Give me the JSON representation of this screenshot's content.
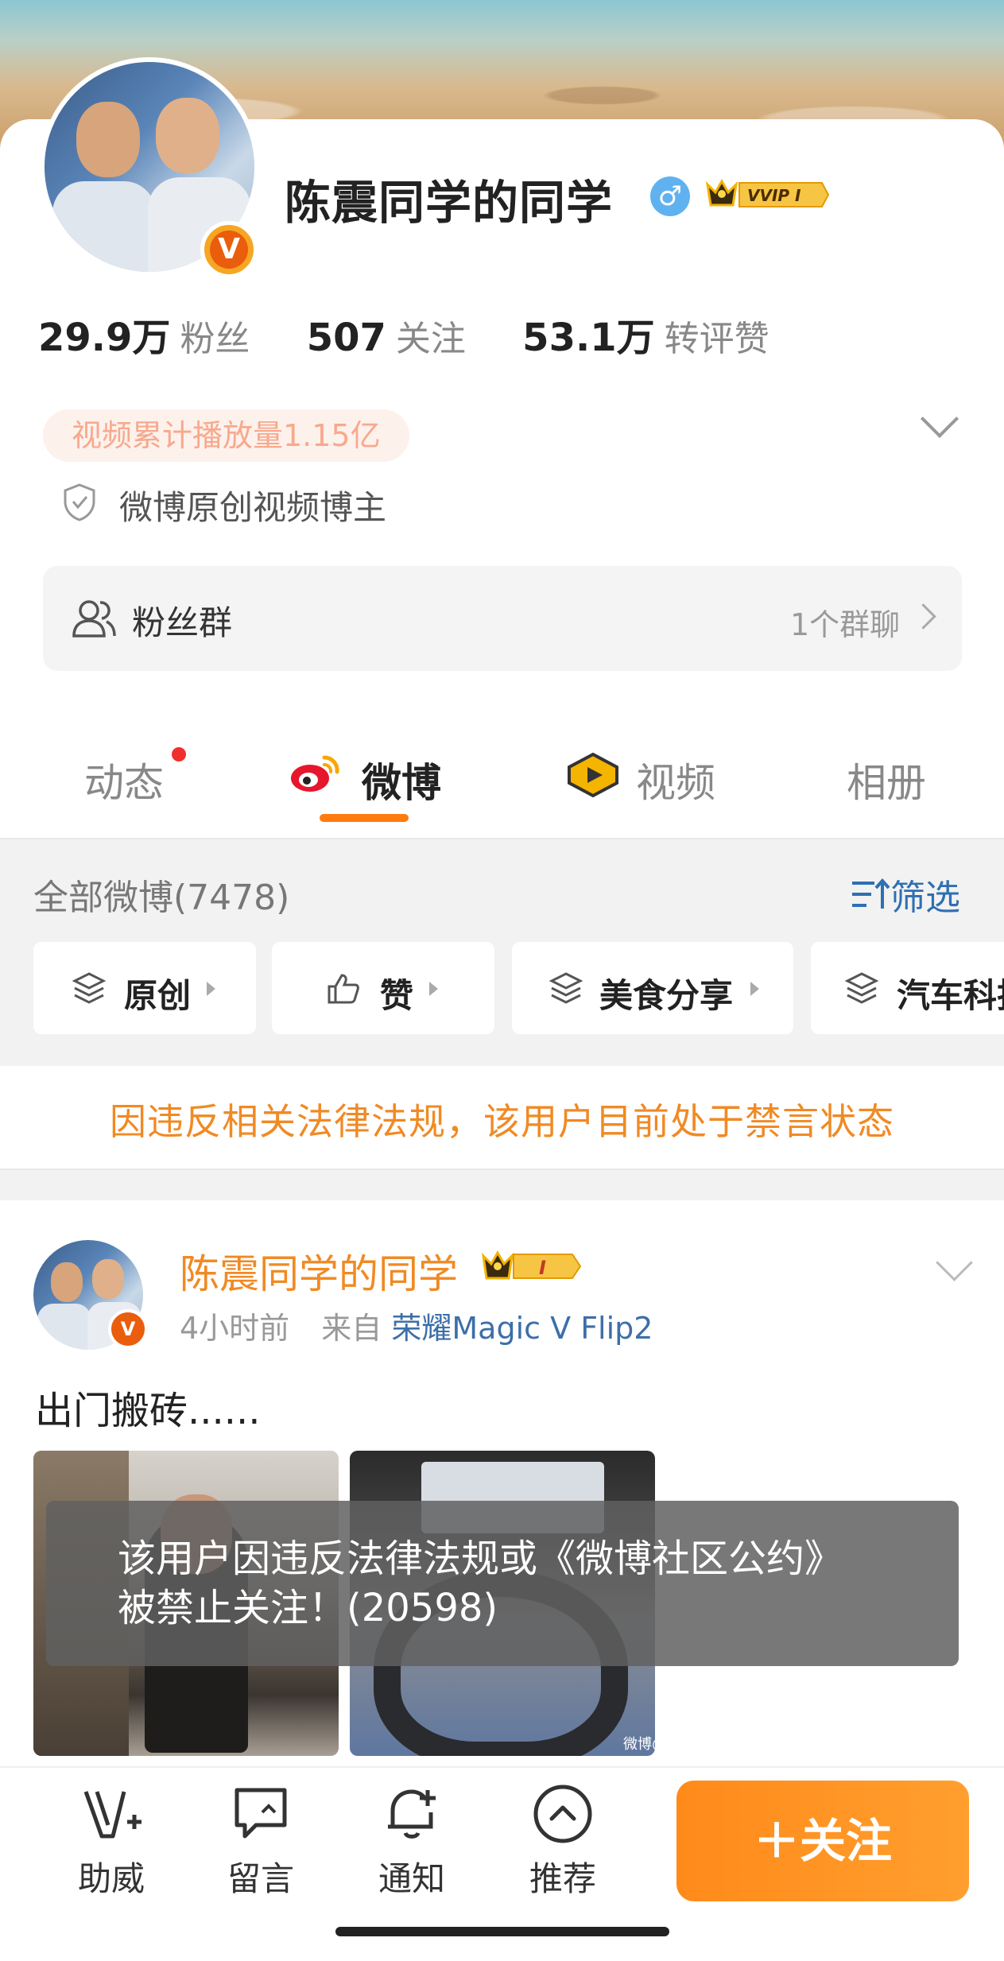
{
  "profile": {
    "name": "陈震同学的同学",
    "gender_symbol": "♂",
    "vip_badge": "VVIP Ⅰ",
    "verified_mark": "V",
    "stats": [
      {
        "value": "29.9万",
        "label": "粉丝"
      },
      {
        "value": "507",
        "label": "关注"
      },
      {
        "value": "53.1万",
        "label": "转评赞"
      }
    ],
    "highlight_pill": "视频累计播放量1.15亿",
    "certification": "微博原创视频博主",
    "fan_group": {
      "label": "粉丝群",
      "count_text": "1个群聊"
    }
  },
  "tabs": [
    {
      "label": "动态"
    },
    {
      "label": "微博"
    },
    {
      "label": "视频"
    },
    {
      "label": "相册"
    }
  ],
  "feed_header": {
    "all_label": "全部微博(7478)",
    "filter_label": "筛选"
  },
  "chips": [
    {
      "label": "原创",
      "icon": "layers-icon"
    },
    {
      "label": "赞",
      "icon": "thumb-up-icon"
    },
    {
      "label": "美食分享",
      "icon": "layers-icon"
    },
    {
      "label": "汽车科技",
      "icon": "layers-icon"
    }
  ],
  "ban_notice": "因违反相关法律法规，该用户目前处于禁言状态",
  "post": {
    "author": "陈震同学的同学",
    "badge": "Ⅰ",
    "time": "4小时前",
    "source_prefix": "来自",
    "device": "荣耀Magic V Flip2",
    "text": "出门搬砖......",
    "watermark": "微博@"
  },
  "overlay_message": "该用户因违反法律法规或《微博社区公约》被禁止关注！(20598)",
  "bottom_nav": [
    {
      "label": "助威",
      "icon": "cheer-icon"
    },
    {
      "label": "留言",
      "icon": "message-icon"
    },
    {
      "label": "通知",
      "icon": "bell-plus-icon"
    },
    {
      "label": "推荐",
      "icon": "chevron-up-circle-icon"
    }
  ],
  "follow_button": "＋关注",
  "colors": {
    "accent": "#ff8a1a",
    "link": "#2f6fb3",
    "notice": "#f08a24",
    "name_orange": "#f08a24"
  }
}
